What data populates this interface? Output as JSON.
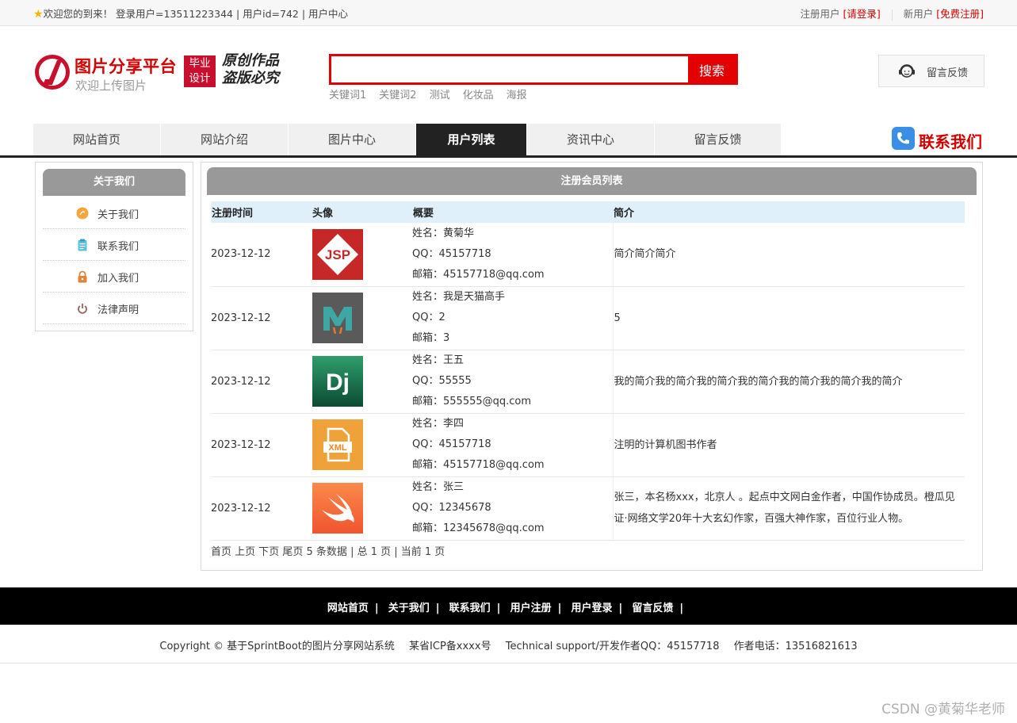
{
  "topbar": {
    "welcome": "欢迎您的到来！ 登录用户=13511223344 | 用户id=742 | 用户中心",
    "register_user_label": "注册用户",
    "login_link": "[请登录]",
    "new_user_label": "新用户",
    "signup_link": "[免费注册]"
  },
  "header": {
    "site_title": "图片分享平台",
    "site_subtitle": "欢迎上传图片",
    "badge_line1": "毕业",
    "badge_line2": "设计",
    "slogan_line1": "原创作品",
    "slogan_line2": "盗版必究",
    "search_placeholder": "",
    "search_button": "搜索",
    "hot_keywords": [
      "关键词1",
      "关键词2",
      "测试",
      "化妆品",
      "海报"
    ],
    "feedback_button": "留言反馈"
  },
  "nav": {
    "items": [
      "网站首页",
      "网站介绍",
      "图片中心",
      "用户列表",
      "资讯中心",
      "留言反馈"
    ],
    "active_index": 3,
    "contact_us": "联系我们"
  },
  "sidebar": {
    "title": "关于我们",
    "items": [
      {
        "label": "关于我们",
        "icon": "orange-circle-icon"
      },
      {
        "label": "联系我们",
        "icon": "clipboard-icon"
      },
      {
        "label": "加入我们",
        "icon": "lock-icon"
      },
      {
        "label": "法律声明",
        "icon": "power-icon"
      }
    ]
  },
  "main": {
    "title": "注册会员列表",
    "columns": [
      "注册时间",
      "头像",
      "概要",
      "简介"
    ],
    "rows": [
      {
        "date": "2023-12-12",
        "avatar": "jsp-icon",
        "name": "姓名：黄菊华",
        "qq": "QQ：45157718",
        "email": "邮箱：45157718@qq.com",
        "intro": "简介简介简介"
      },
      {
        "date": "2023-12-12",
        "avatar": "m-icon",
        "name": "姓名：我是天猫高手",
        "qq": "QQ：2",
        "email": "邮箱：3",
        "intro": "5"
      },
      {
        "date": "2023-12-12",
        "avatar": "django-icon",
        "name": "姓名：王五",
        "qq": "QQ：55555",
        "email": "邮箱：555555@qq.com",
        "intro": "我的简介我的简介我的简介我的简介我的简介我的简介我的简介"
      },
      {
        "date": "2023-12-12",
        "avatar": "xml-file-icon",
        "name": "姓名：李四",
        "qq": "QQ：45157718",
        "email": "邮箱：45157718@qq.com",
        "intro": "注明的计算机图书作者"
      },
      {
        "date": "2023-12-12",
        "avatar": "swift-icon",
        "name": "姓名：张三",
        "qq": "QQ：12345678",
        "email": "邮箱：12345678@qq.com",
        "intro": "张三，本名杨xxx，北京人 。起点中文网白金作者，中国作协成员。橙瓜见证·网络文学20年十大玄幻作家，百强大神作家，百位行业人物。"
      }
    ],
    "pager": "首页 上页 下页 尾页 5 条数据 | 总 1 页 | 当前 1 页"
  },
  "footer": {
    "links": [
      "网站首页",
      "关于我们",
      "联系我们",
      "用户注册",
      "用户登录",
      "留言反馈"
    ],
    "copyright": "Copyright © 基于SprintBoot的图片分享网站系统",
    "icp": "某省ICP备xxxx号",
    "support": "Technical support/开发作者QQ：45157718",
    "phone": "作者电话：13516821613"
  },
  "watermark": "CSDN @黄菊华老师",
  "colors": {
    "brand_red": "#d40000",
    "nav_active": "#222222",
    "panel_header": "#999999",
    "table_header": "#dff0fb"
  }
}
